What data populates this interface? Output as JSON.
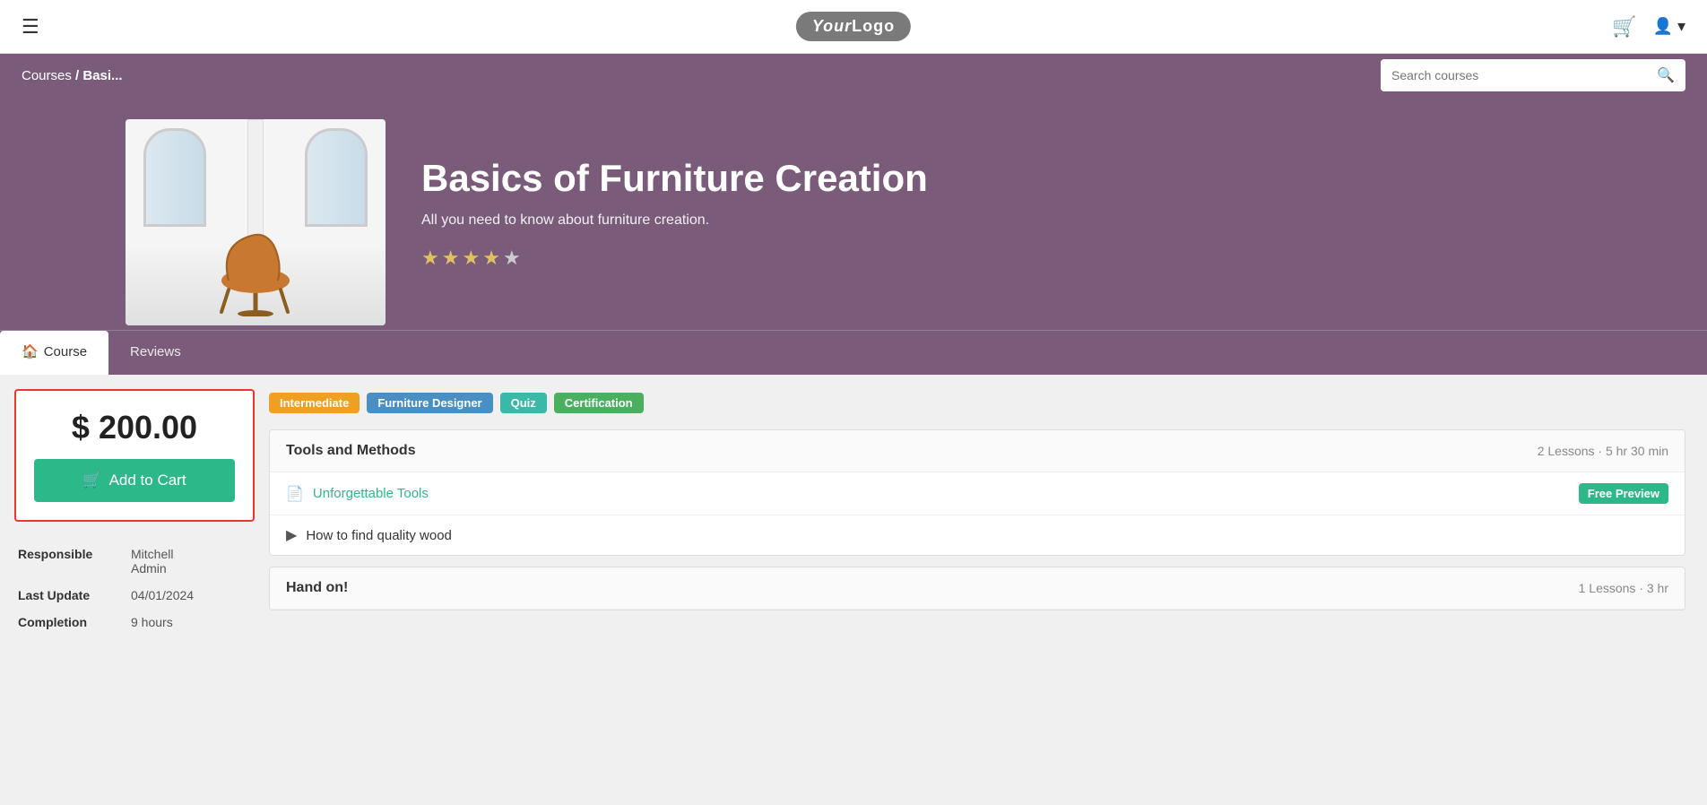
{
  "nav": {
    "logo": "YourLogo",
    "logo_your": "Your",
    "logo_logo": "Logo"
  },
  "breadcrumb": {
    "courses_label": "Courses",
    "separator": "/",
    "current": "Basi..."
  },
  "search": {
    "placeholder": "Search courses"
  },
  "hero": {
    "title": "Basics of Furniture Creation",
    "subtitle": "All you need to know about furniture creation.",
    "stars": [
      true,
      true,
      true,
      true,
      false
    ]
  },
  "tabs": [
    {
      "id": "course",
      "label": "Course",
      "icon": "🏠",
      "active": true
    },
    {
      "id": "reviews",
      "label": "Reviews",
      "icon": "",
      "active": false
    }
  ],
  "price_card": {
    "price": "$ 200.00",
    "add_to_cart": "Add to Cart"
  },
  "meta": {
    "responsible_label": "Responsible",
    "responsible_value1": "Mitchell",
    "responsible_value2": "Admin",
    "last_update_label": "Last Update",
    "last_update_value": "04/01/2024",
    "completion_label": "Completion",
    "completion_value": "9 hours"
  },
  "tags": [
    {
      "label": "Intermediate",
      "class": "tag-orange"
    },
    {
      "label": "Furniture Designer",
      "class": "tag-blue"
    },
    {
      "label": "Quiz",
      "class": "tag-teal"
    },
    {
      "label": "Certification",
      "class": "tag-green"
    }
  ],
  "sections": [
    {
      "title": "Tools and Methods",
      "lessons_count": "2 Lessons · 5 hr 30 min",
      "lessons": [
        {
          "type": "doc",
          "text": "Unforgettable Tools",
          "is_link": true,
          "badge": "Free Preview"
        },
        {
          "type": "play",
          "text": "How to find quality wood",
          "is_link": false,
          "badge": null
        }
      ]
    },
    {
      "title": "Hand on!",
      "lessons_count": "1 Lessons · 3 hr",
      "lessons": []
    }
  ]
}
